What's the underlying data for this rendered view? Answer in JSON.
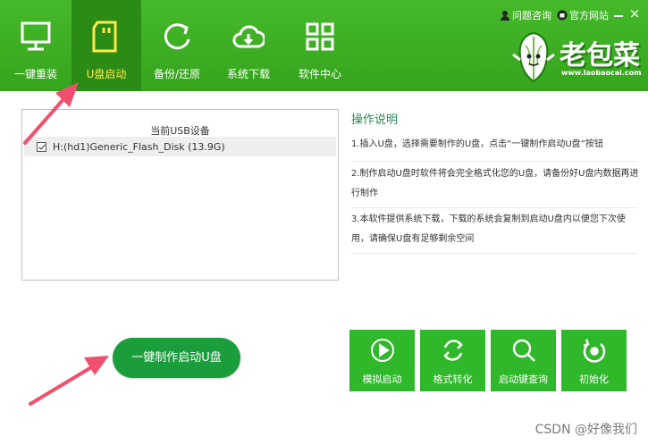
{
  "nav": [
    {
      "label": "一键重装",
      "icon": "monitor-icon"
    },
    {
      "label": "U盘启动",
      "icon": "usb-drive-icon",
      "active": true
    },
    {
      "label": "备份/还原",
      "icon": "refresh-icon"
    },
    {
      "label": "系统下载",
      "icon": "cloud-download-icon"
    },
    {
      "label": "软件中心",
      "icon": "grid-icon"
    }
  ],
  "top_links": {
    "help": "问题咨询",
    "site": "官方网站"
  },
  "logo": {
    "text": "老包菜",
    "url": "www.laobaocai.com"
  },
  "devices": {
    "header": "当前USB设备",
    "items": [
      {
        "name": "H:(hd1)Generic_Flash_Disk (13.9G)",
        "checked": true
      }
    ]
  },
  "instructions": {
    "title": "操作说明",
    "steps": [
      "1.插入U盘，选择需要制作的U盘，点击“一键制作启动U盘”按钮",
      "2.制作启动U盘时软件将会完全格式化您的U盘，请备份好U盘内数据再进行制作",
      "3.本软件提供系统下载，下载的系统会复制到启动U盘内以便您下次使用，请确保U盘有足够剩余空间"
    ]
  },
  "actions": {
    "make_label": "一键制作启动U盘",
    "tools": [
      "模拟启动",
      "格式转化",
      "启动键查询",
      "初始化"
    ]
  },
  "watermark": "CSDN @好像我们",
  "colors": {
    "header": "#3cb022",
    "active_tab": "#2a8c14",
    "tool_button": "#2fb82a",
    "make_button": "#1a9e3c",
    "arrow": "#f0506e"
  }
}
